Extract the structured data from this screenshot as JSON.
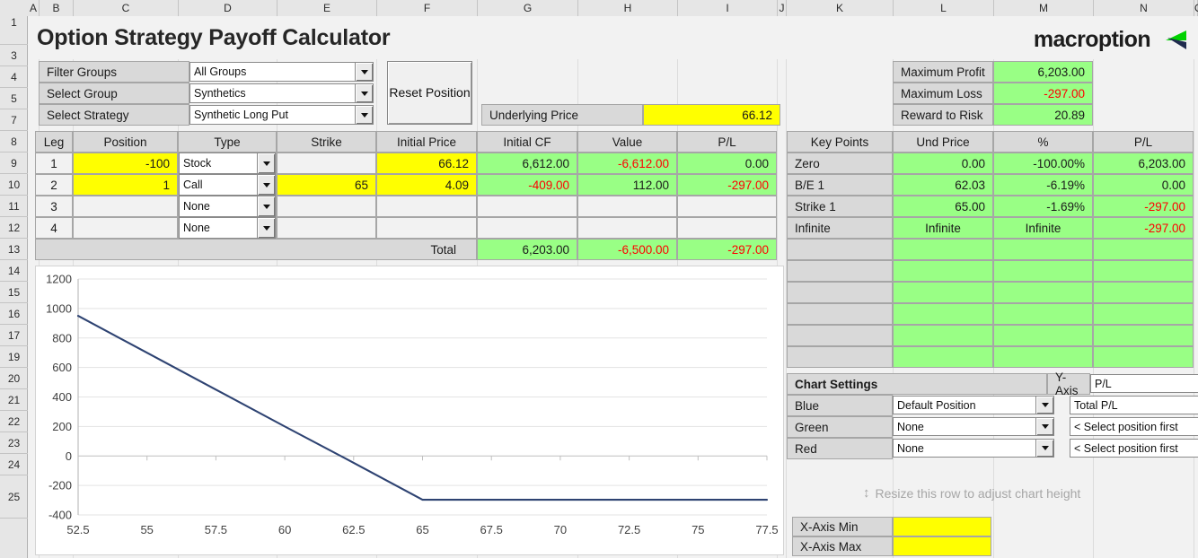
{
  "app": {
    "title": "Option Strategy Payoff Calculator",
    "brand": "macroption"
  },
  "grid": {
    "columns": [
      "A",
      "B",
      "C",
      "D",
      "E",
      "F",
      "G",
      "H",
      "I",
      "J",
      "K",
      "L",
      "M",
      "N",
      "O"
    ],
    "rows": [
      "1",
      "3",
      "4",
      "5",
      "7",
      "8",
      "9",
      "10",
      "11",
      "12",
      "13",
      "14",
      "15",
      "16",
      "17",
      "19",
      "20",
      "21",
      "22",
      "23",
      "24",
      "25"
    ]
  },
  "selectors": {
    "filter_groups_label": "Filter Groups",
    "filter_groups_value": "All Groups",
    "select_group_label": "Select Group",
    "select_group_value": "Synthetics",
    "select_strategy_label": "Select Strategy",
    "select_strategy_value": "Synthetic Long Put",
    "reset_button": "Reset Position",
    "underlying_price_label": "Underlying Price",
    "underlying_price_value": "66.12"
  },
  "summary": {
    "rows": [
      {
        "label": "Maximum Profit",
        "value": "6,203.00",
        "negative": false
      },
      {
        "label": "Maximum Loss",
        "value": "-297.00",
        "negative": true
      },
      {
        "label": "Reward to Risk",
        "value": "20.89",
        "negative": false
      }
    ]
  },
  "legs": {
    "headers": [
      "Leg",
      "Position",
      "Type",
      "Strike",
      "Initial Price",
      "Initial CF",
      "Value",
      "P/L"
    ],
    "rows": [
      {
        "leg": "1",
        "position": "-100",
        "type": "Stock",
        "strike": "",
        "initial_price": "66.12",
        "initial_cf": "6,612.00",
        "value": "-6,612.00",
        "pl": "0.00"
      },
      {
        "leg": "2",
        "position": "1",
        "type": "Call",
        "strike": "65",
        "initial_price": "4.09",
        "initial_cf": "-409.00",
        "value": "112.00",
        "pl": "-297.00"
      },
      {
        "leg": "3",
        "position": "",
        "type": "None",
        "strike": "",
        "initial_price": "",
        "initial_cf": "",
        "value": "",
        "pl": ""
      },
      {
        "leg": "4",
        "position": "",
        "type": "None",
        "strike": "",
        "initial_price": "",
        "initial_cf": "",
        "value": "",
        "pl": ""
      }
    ],
    "total_label": "Total",
    "total_initial_cf": "6,203.00",
    "total_value": "-6,500.00",
    "total_pl": "-297.00"
  },
  "key_points": {
    "headers": [
      "Key Points",
      "Und Price",
      "%",
      "P/L"
    ],
    "rows": [
      {
        "name": "Zero",
        "und_price": "0.00",
        "pct": "-100.00%",
        "pl": "6,203.00",
        "pl_negative": false
      },
      {
        "name": "B/E 1",
        "und_price": "62.03",
        "pct": "-6.19%",
        "pl": "0.00",
        "pl_negative": false
      },
      {
        "name": "Strike 1",
        "und_price": "65.00",
        "pct": "-1.69%",
        "pl": "-297.00",
        "pl_negative": true
      },
      {
        "name": "Infinite",
        "und_price": "Infinite",
        "pct": "Infinite",
        "pl": "-297.00",
        "pl_negative": true
      },
      {
        "name": "",
        "und_price": "",
        "pct": "",
        "pl": "",
        "pl_negative": false
      },
      {
        "name": "",
        "und_price": "",
        "pct": "",
        "pl": "",
        "pl_negative": false
      },
      {
        "name": "",
        "und_price": "",
        "pct": "",
        "pl": "",
        "pl_negative": false
      },
      {
        "name": "",
        "und_price": "",
        "pct": "",
        "pl": "",
        "pl_negative": false
      },
      {
        "name": "",
        "und_price": "",
        "pct": "",
        "pl": "",
        "pl_negative": false
      },
      {
        "name": "",
        "und_price": "",
        "pct": "",
        "pl": "",
        "pl_negative": false
      }
    ]
  },
  "chart_settings": {
    "title": "Chart Settings",
    "yaxis_label": "Y-Axis",
    "yaxis_value": "P/L",
    "rows": [
      {
        "color_label": "Blue",
        "position": "Default Position",
        "series": "Total P/L"
      },
      {
        "color_label": "Green",
        "position": "None",
        "series": "< Select position first"
      },
      {
        "color_label": "Red",
        "position": "None",
        "series": "< Select position first"
      }
    ],
    "resize_hint": "Resize this row to adjust chart height",
    "xaxis_min_label": "X-Axis Min",
    "xaxis_min_value": "",
    "xaxis_max_label": "X-Axis Max",
    "xaxis_max_value": ""
  },
  "colors": {
    "input_yellow": "#FFFF00",
    "output_green": "#99FF85",
    "label_gray": "#D9D9D9",
    "negative_red": "#FF0000",
    "series_blue": "#2E4372",
    "logo_green": "#00D200",
    "logo_navy": "#1F2B4D"
  },
  "chart_data": {
    "type": "line",
    "title": "",
    "xlabel": "",
    "ylabel": "",
    "xlim": [
      52.5,
      77.5
    ],
    "ylim": [
      -400,
      1200
    ],
    "grid": true,
    "legend": false,
    "xticks": [
      "52.5",
      "55",
      "57.5",
      "60",
      "62.5",
      "65",
      "67.5",
      "70",
      "72.5",
      "75",
      "77.5"
    ],
    "yticks": [
      "-400",
      "-200",
      "0",
      "200",
      "400",
      "600",
      "800",
      "1000",
      "1200"
    ],
    "series": [
      {
        "name": "Total P/L",
        "color": "#2E4372",
        "x": [
          52.5,
          55,
          57.5,
          60,
          62.03,
          62.5,
          65,
          67.5,
          70,
          72.5,
          75,
          77.5
        ],
        "y": [
          950,
          700,
          450,
          200,
          0,
          -47,
          -297,
          -297,
          -297,
          -297,
          -297,
          -297
        ]
      }
    ]
  }
}
